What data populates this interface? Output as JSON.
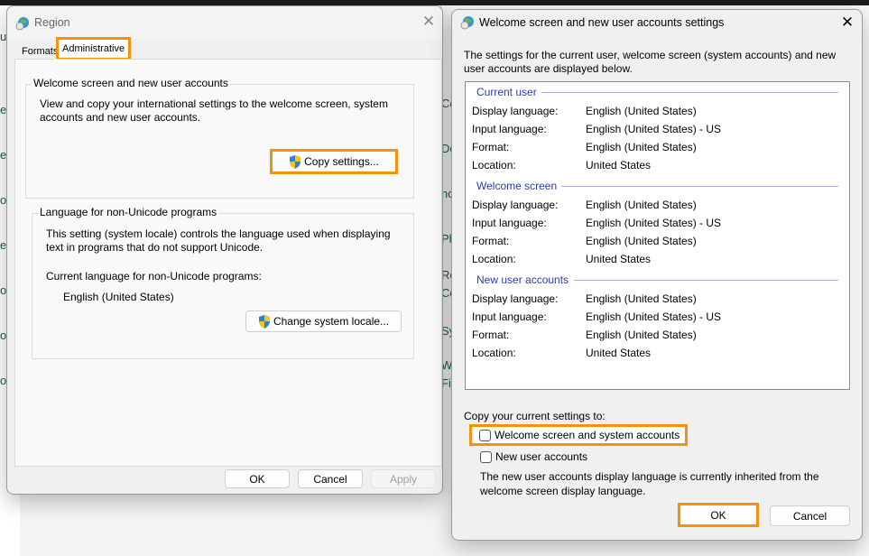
{
  "background": {
    "left_fragments": [
      "ut",
      "ef",
      "e",
      "o",
      "ec",
      "oe",
      "o",
      "o"
    ],
    "middle_fragments": [
      "Co",
      "De",
      "nc",
      "Ph",
      "Re",
      "Co",
      "Sy",
      "W",
      "Fir"
    ]
  },
  "region_dialog": {
    "title": "Region",
    "tabs": [
      {
        "label": "Formats",
        "active": false
      },
      {
        "label": "Administrative",
        "active": true
      }
    ],
    "welcome_group": {
      "legend": "Welcome screen and new user accounts",
      "description_line1": "View and copy your international settings to the welcome screen, system",
      "description_line2": "accounts and new user accounts.",
      "copy_button": "Copy settings..."
    },
    "unicode_group": {
      "legend": "Language for non-Unicode programs",
      "description_line1": "This setting (system locale) controls the language used when displaying",
      "description_line2": "text in programs that do not support Unicode.",
      "current_label": "Current language for non-Unicode programs:",
      "current_value": "English (United States)",
      "change_button": "Change system locale..."
    },
    "buttons": {
      "ok": "OK",
      "cancel": "Cancel",
      "apply": "Apply"
    }
  },
  "welcome_dialog": {
    "title": "Welcome screen and new user accounts settings",
    "intro_line1": "The settings for the current user, welcome screen (system accounts) and new",
    "intro_line2": "user accounts are displayed below.",
    "sections": [
      {
        "heading": "Current user",
        "rows": [
          {
            "label": "Display language:",
            "value": "English (United States)"
          },
          {
            "label": "Input language:",
            "value": "English (United States) - US"
          },
          {
            "label": "Format:",
            "value": "English (United States)"
          },
          {
            "label": "Location:",
            "value": "United States"
          }
        ]
      },
      {
        "heading": "Welcome screen",
        "rows": [
          {
            "label": "Display language:",
            "value": "English (United States)"
          },
          {
            "label": "Input language:",
            "value": "English (United States) - US"
          },
          {
            "label": "Format:",
            "value": "English (United States)"
          },
          {
            "label": "Location:",
            "value": "United States"
          }
        ]
      },
      {
        "heading": "New user accounts",
        "rows": [
          {
            "label": "Display language:",
            "value": "English (United States)"
          },
          {
            "label": "Input language:",
            "value": "English (United States) - US"
          },
          {
            "label": "Format:",
            "value": "English (United States)"
          },
          {
            "label": "Location:",
            "value": "United States"
          }
        ]
      }
    ],
    "copy_label": "Copy your current settings to:",
    "checkboxes": [
      {
        "label": "Welcome screen and system accounts",
        "checked": false
      },
      {
        "label": "New user accounts",
        "checked": false
      }
    ],
    "note_line1": "The new user accounts display language is currently inherited from the",
    "note_line2": "welcome screen display language.",
    "buttons": {
      "ok": "OK",
      "cancel": "Cancel"
    }
  },
  "colors": {
    "highlight": "#f7900a",
    "section_heading": "#2b3fa8"
  }
}
